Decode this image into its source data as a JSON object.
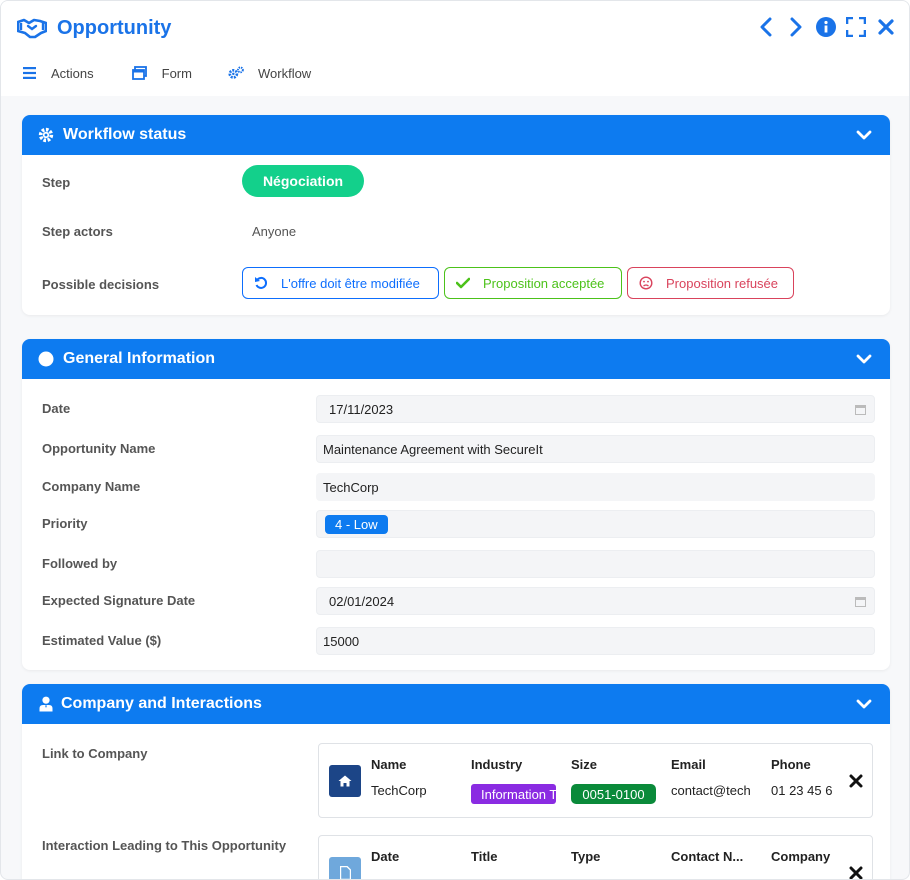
{
  "header": {
    "title": "Opportunity"
  },
  "tabs": [
    {
      "label": "Actions",
      "icon": "menu-icon"
    },
    {
      "label": "Form",
      "icon": "form-icon"
    },
    {
      "label": "Workflow",
      "icon": "gears-icon"
    }
  ],
  "workflow": {
    "title": "Workflow status",
    "step_label": "Step",
    "step_value": "Négociation",
    "actors_label": "Step actors",
    "actors_value": "Anyone",
    "decisions_label": "Possible decisions",
    "decisions": [
      {
        "label": "L'offre doit être modifiée",
        "color": "#0d6efd"
      },
      {
        "label": "Proposition acceptée",
        "color": "#4cc21a"
      },
      {
        "label": "Proposition refusée",
        "color": "#d9435c"
      }
    ]
  },
  "general": {
    "title": "General Information",
    "fields": [
      {
        "label": "Date",
        "value": "17/11/2023"
      },
      {
        "label": "Opportunity Name",
        "value": "Maintenance Agreement with SecureIt"
      },
      {
        "label": "Company Name",
        "value": "TechCorp"
      },
      {
        "label": "Priority",
        "value": "4 - Low"
      },
      {
        "label": "Followed by",
        "value": ""
      },
      {
        "label": "Expected Signature Date",
        "value": "02/01/2024"
      },
      {
        "label": "Estimated Value ($)",
        "value": "15000"
      }
    ]
  },
  "company": {
    "title": "Company and Interactions",
    "link_label": "Link to Company",
    "link_headers": [
      "Name",
      "Industry",
      "Size",
      "Email",
      "Phone"
    ],
    "link_row": {
      "name": "TechCorp",
      "industry": "Information T",
      "size": "0051-0100",
      "email": "contact@tech",
      "phone": "01 23 45 6"
    },
    "interaction_label": "Interaction Leading to This Opportunity",
    "interaction_headers": [
      "Date",
      "Title",
      "Type",
      "Contact N...",
      "Company"
    ]
  },
  "colors": {
    "brand": "#0d7bf0",
    "step": "#13d08b",
    "industry_tag": "#8a2be2",
    "size_tag": "#0a8a3a",
    "company_icon_bg": "#1c4587",
    "interaction_icon_bg": "#6fa8dc"
  }
}
